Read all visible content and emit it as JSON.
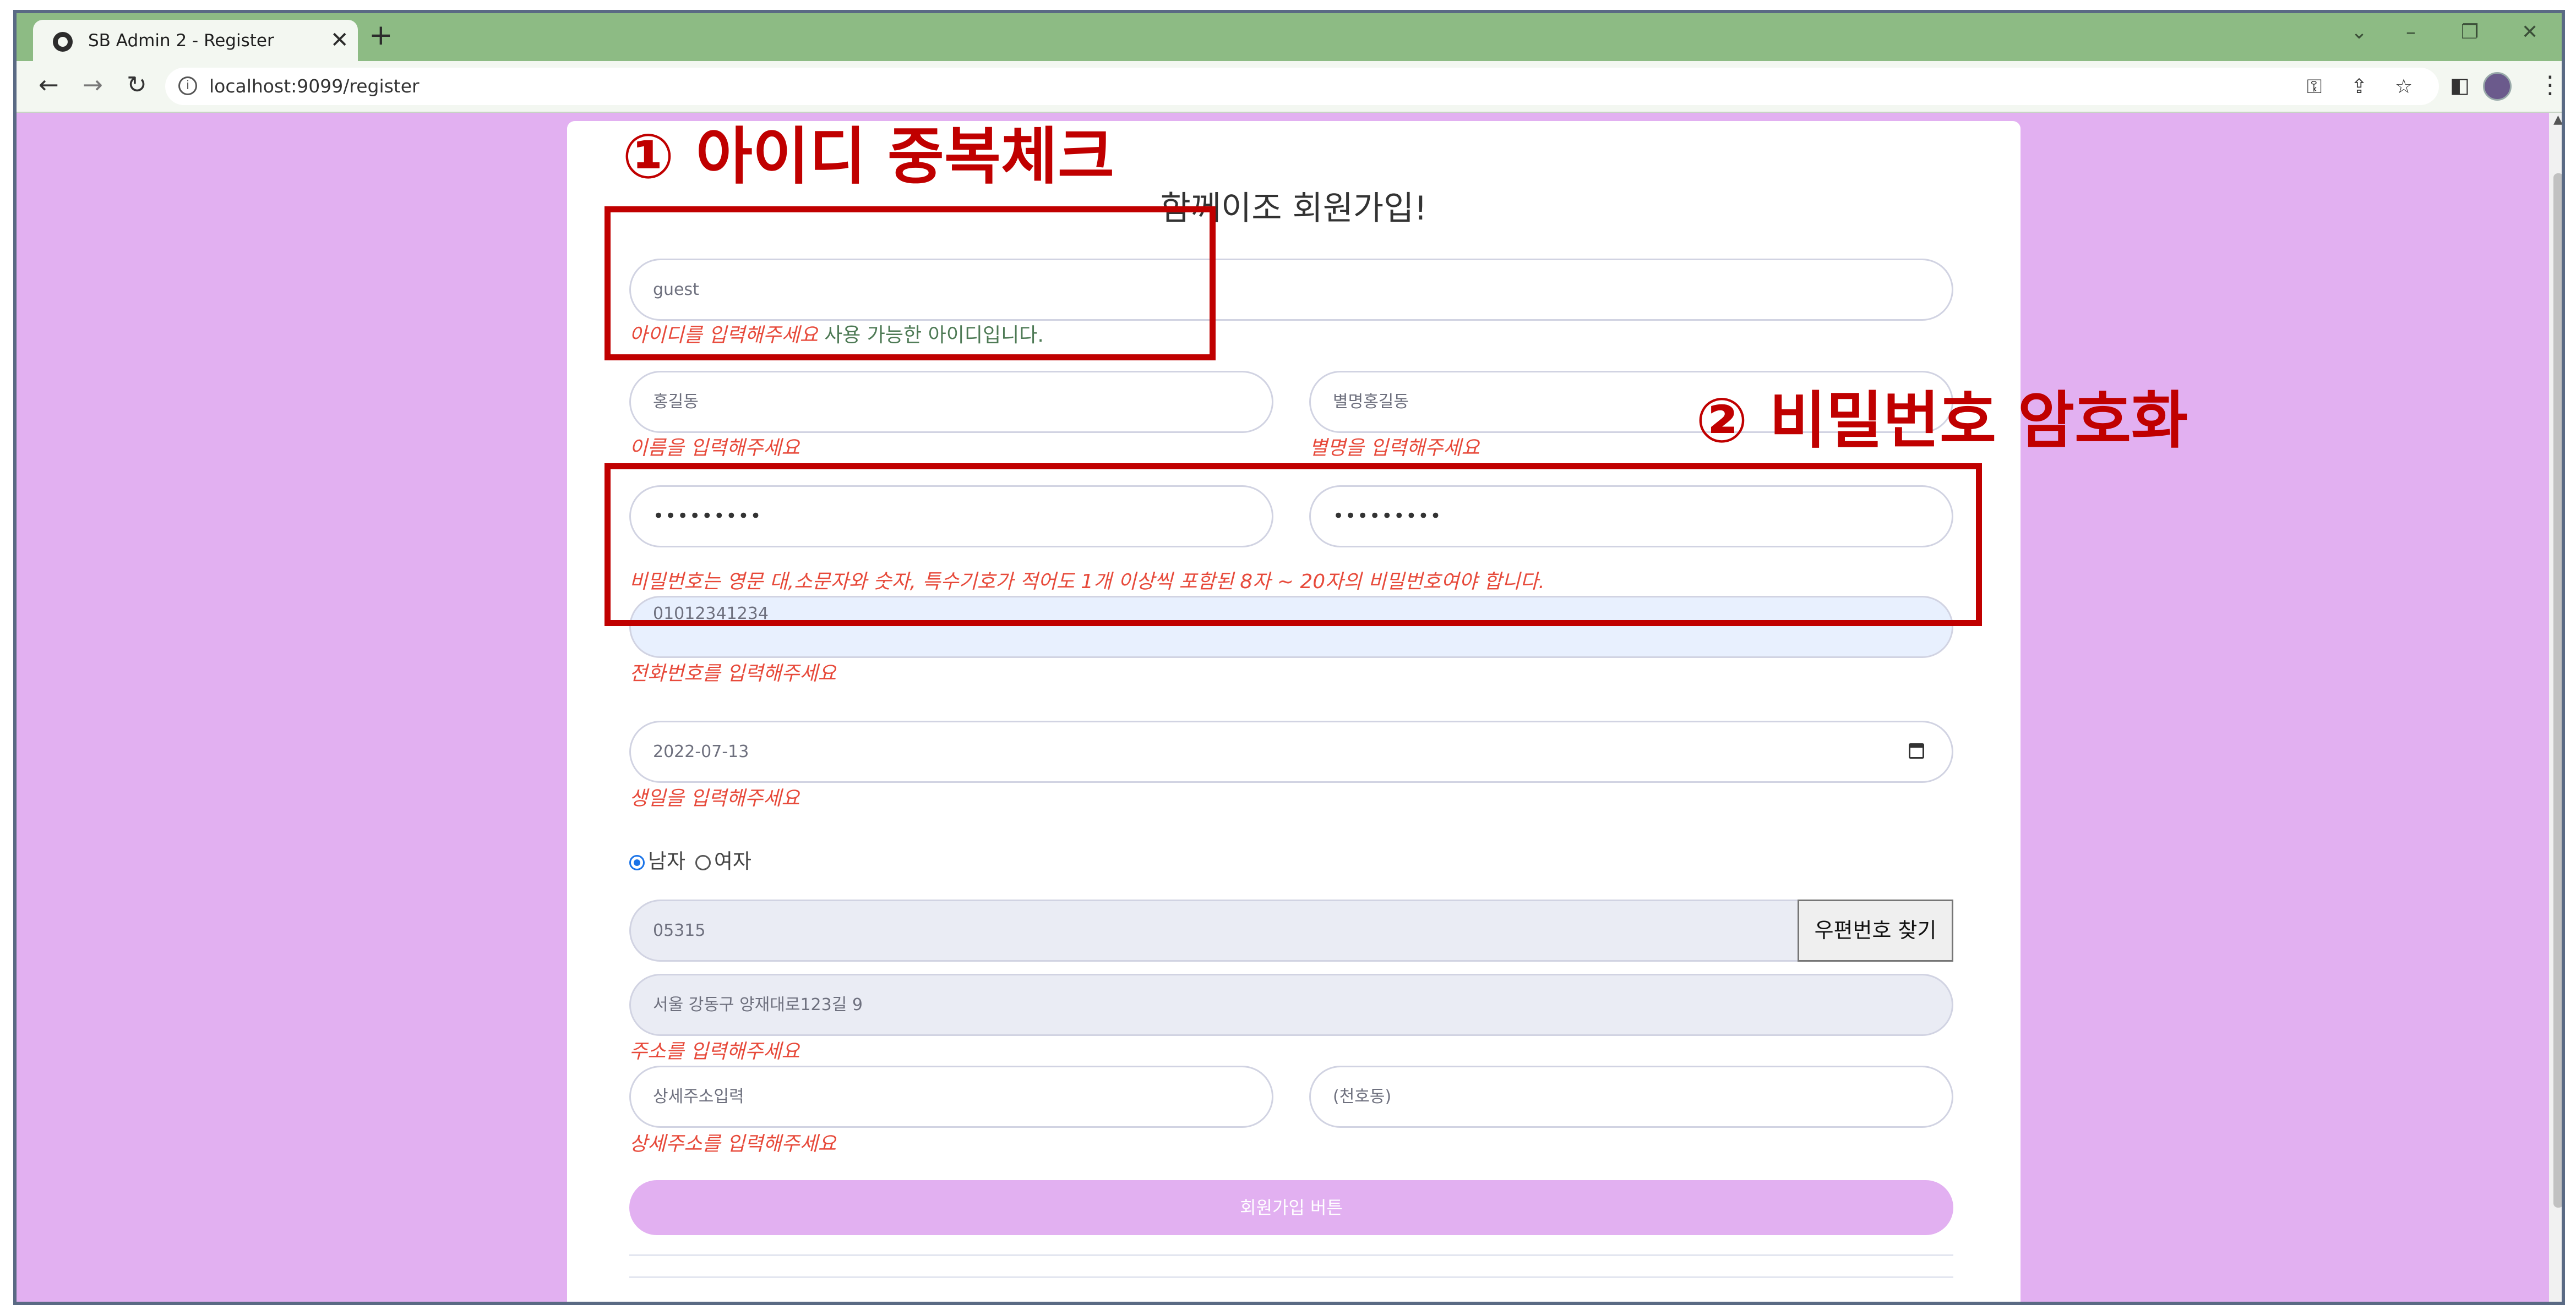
{
  "browser": {
    "tab_title": "SB Admin 2 - Register",
    "tab_close": "✕",
    "new_tab": "+",
    "url": "localhost:9099/register",
    "win_controls": [
      "⌄",
      "–",
      "❐",
      "✕"
    ]
  },
  "form": {
    "heading": "함께이조 회원가입!",
    "user_id": {
      "value": "guest",
      "hint": "아이디를 입력해주세요",
      "status": "사용 가능한 아이디입니다."
    },
    "name": {
      "value": "홍길동",
      "hint": "이름을 입력해주세요"
    },
    "nickname": {
      "value": "별명홍길동",
      "hint": "별명을 입력해주세요"
    },
    "password": {
      "value": "•••••••••",
      "hint": "비밀번호는 영문 대,소문자와 숫자, 특수기호가 적어도 1개 이상씩 포함된 8자 ~ 20자의 비밀번호여야 합니다."
    },
    "password_confirm": {
      "value": "•••••••••"
    },
    "phone": {
      "value": "01012341234",
      "hint": "전화번호를 입력해주세요"
    },
    "birthday": {
      "value": "2022-07-13",
      "hint": "생일을 입력해주세요"
    },
    "gender": {
      "male": "남자",
      "female": "여자",
      "selected": "남자"
    },
    "postcode": {
      "value": "05315",
      "button": "우편번호 찾기"
    },
    "address": {
      "value": "서울 강동구 양재대로123길 9",
      "hint": "주소를 입력해주세요"
    },
    "address_detail": {
      "placeholder": "상세주소입력",
      "extra": "(천호동)",
      "hint": "상세주소를 입력해주세요"
    },
    "submit": "회원가입 버튼"
  },
  "annotations": {
    "label_1": "① 아이디 중복체크",
    "label_2": "② 비밀번호 암호화",
    "color": "#c00000"
  },
  "colors": {
    "page_bg": "#e2b0f1",
    "tab_bar": "#8dbb84",
    "error": "#e74a3b",
    "success": "#4e7a55"
  }
}
